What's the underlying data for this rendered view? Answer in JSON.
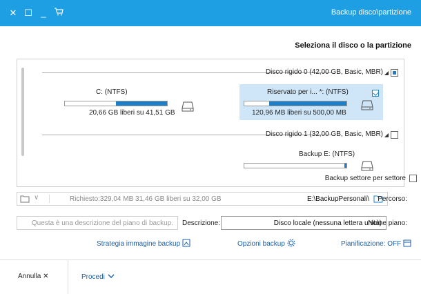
{
  "window": {
    "title": "Backup disco\\partizione",
    "controls": {
      "cart_icon": "cart-icon",
      "minimize": "_",
      "maximize": "☐",
      "close": "✕"
    }
  },
  "section_title": "Seleziona il disco o la partizione",
  "disks": [
    {
      "label": "Disco rigido 0 (42,00 GB, Basic, MBR)",
      "checked": true,
      "partitions": [
        {
          "name": "Riservato per i... *: (NTFS)",
          "space": "120,96 MB liberi su 500,00 MB",
          "used_fraction": 0.76,
          "selected": true,
          "checked": true
        },
        {
          "name": "C: (NTFS)",
          "space": "20,66 GB liberi su 41,51 GB",
          "used_fraction": 0.5,
          "selected": false,
          "checked": false
        }
      ]
    },
    {
      "label": "Disco rigido 1 (32,00 GB, Basic, MBR)",
      "checked": false,
      "partitions": [
        {
          "name": "Backup E: (NTFS)",
          "space": "",
          "used_fraction": 0.02,
          "selected": false,
          "checked": false
        }
      ]
    }
  ],
  "sector_backup": {
    "label": "Backup settore per settore",
    "checked": false
  },
  "path": {
    "label": "Percorso:",
    "value": "E:\\BackupPersonali\\",
    "space_info": "Richiesto:329,04 MB   31,46 GB liberi su 32,00 GB"
  },
  "plan": {
    "label": "Nome piano:",
    "value": "Disco locale (nessuna lettera unità)"
  },
  "description": {
    "label": "Descrizione:",
    "placeholder": "Questa è una descrizione del piano di backup."
  },
  "links": {
    "schedule": "Pianificazione: OFF",
    "options": "Opzioni backup",
    "strategy": "Strategia immagine backup"
  },
  "footer": {
    "proceed": "Procedi",
    "cancel": "Annulla"
  },
  "colors": {
    "titlebar": "#1e9ee3",
    "accent": "#1e7fc9",
    "selected_bg": "#cfe6f8"
  }
}
